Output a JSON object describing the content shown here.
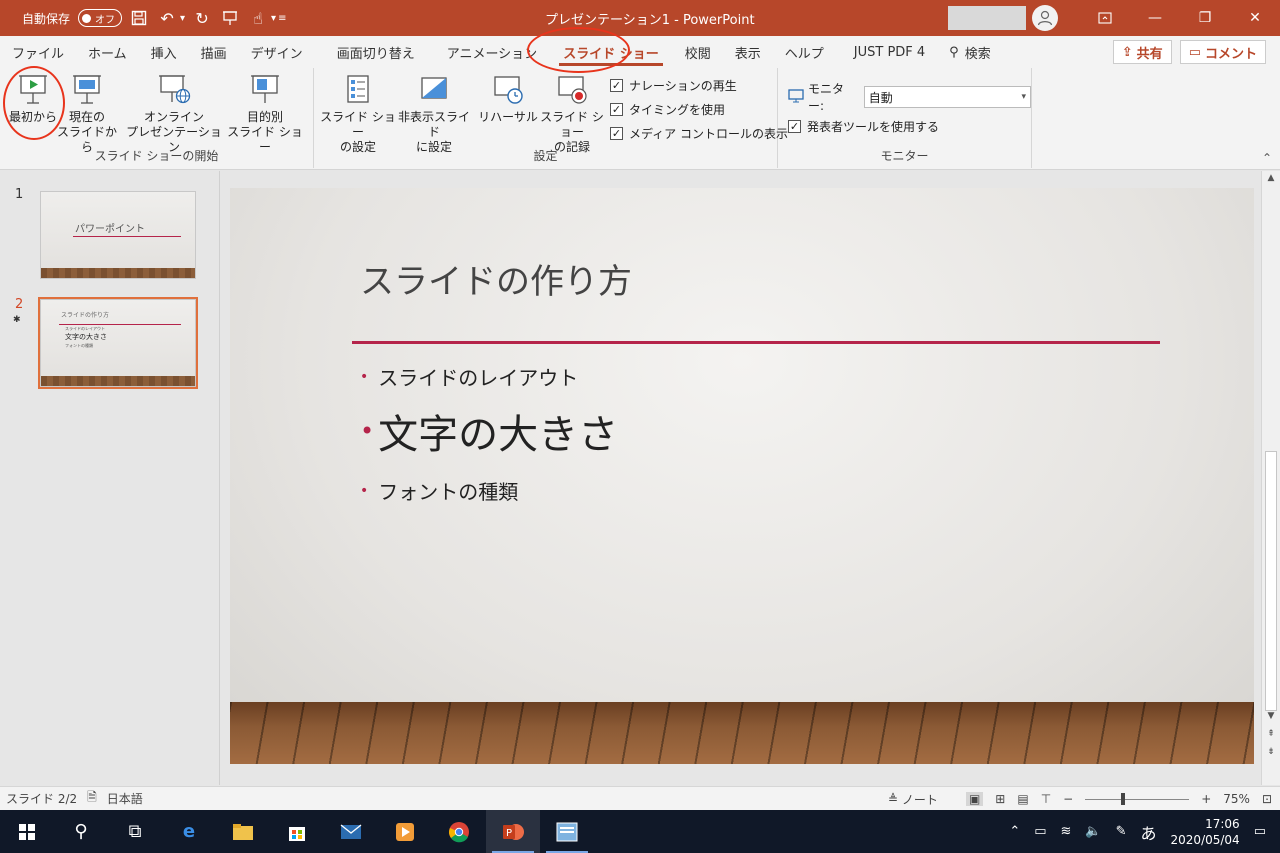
{
  "titlebar": {
    "autosave_label": "自動保存",
    "autosave_state": "オフ",
    "title": "プレゼンテーション1  -  PowerPoint"
  },
  "tabs": [
    {
      "label": "ファイル"
    },
    {
      "label": "ホーム"
    },
    {
      "label": "挿入"
    },
    {
      "label": "描画"
    },
    {
      "label": "デザイン"
    },
    {
      "label": "画面切り替え"
    },
    {
      "label": "アニメーション"
    },
    {
      "label": "スライド ショー",
      "active": true
    },
    {
      "label": "校閲"
    },
    {
      "label": "表示"
    },
    {
      "label": "ヘルプ"
    },
    {
      "label": "JUST PDF 4"
    },
    {
      "label": "検索"
    }
  ],
  "share": {
    "share_label": "共有",
    "comment_label": "コメント"
  },
  "ribbon": {
    "start_group": {
      "label": "スライド ショーの開始",
      "from_beginning": "最初から",
      "from_current_1": "現在の",
      "from_current_2": "スライドから",
      "online_1": "オンライン",
      "online_2": "プレゼンテーション",
      "custom_1": "目的別",
      "custom_2": "スライド ショー"
    },
    "setup_group": {
      "label": "設定",
      "setup_1": "スライド ショー",
      "setup_2": "の設定",
      "hide_1": "非表示スライド",
      "hide_2": "に設定",
      "rehearse": "リハーサル",
      "record_1": "スライド ショー",
      "record_2": "の記録",
      "check_narration": "ナレーションの再生",
      "check_timing": "タイミングを使用",
      "check_media": "メディア コントロールの表示"
    },
    "monitor_group": {
      "label": "モニター",
      "monitor_label": "モニター:",
      "monitor_value": "自動",
      "presenter_view": "発表者ツールを使用する"
    }
  },
  "thumbnails": [
    {
      "number": "1",
      "title": "パワーポイント"
    },
    {
      "number": "2",
      "title": "スライドの作り方",
      "b1": "スライドのレイアウト",
      "b2": "文字の大きさ",
      "b3": "フォントの種類"
    }
  ],
  "slide": {
    "title": "スライドの作り方",
    "bullets": [
      "スライドのレイアウト",
      "文字の大きさ",
      "フォントの種類"
    ]
  },
  "status": {
    "slide_pos": "スライド 2/2",
    "language": "日本語",
    "notes": "ノート",
    "zoom": "75%"
  },
  "taskbar": {
    "time": "17:06",
    "date": "2020/05/04",
    "ime": "あ"
  },
  "colors": {
    "accent": "#b7472a",
    "highlight_circle": "#e8341c",
    "slide_rule": "#b5244a"
  }
}
